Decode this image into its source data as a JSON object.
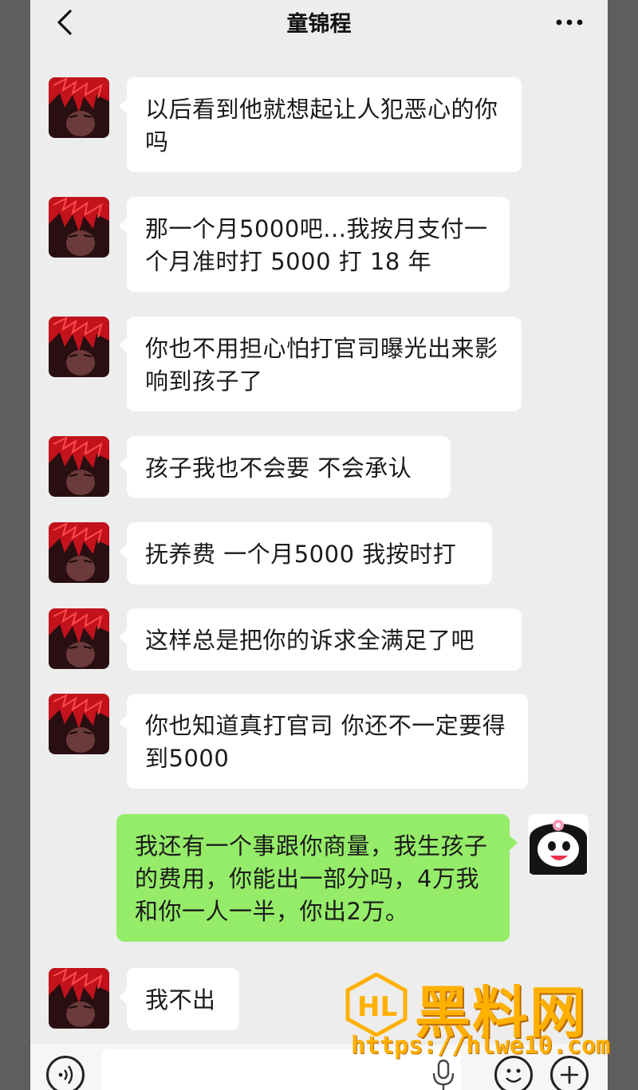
{
  "header": {
    "title": "童锦程"
  },
  "messages": [
    {
      "sender": "contact",
      "text": "以后看到他就想起让人犯恶心的你吗"
    },
    {
      "sender": "contact",
      "text": "那一个月5000吧...我按月支付一个月准时打 5000 打 18 年"
    },
    {
      "sender": "contact",
      "text": "你也不用担心怕打官司曝光出来影响到孩子了"
    },
    {
      "sender": "contact",
      "text": "孩子我也不会要 不会承认"
    },
    {
      "sender": "contact",
      "text": "抚养费 一个月5000 我按时打"
    },
    {
      "sender": "contact",
      "text": "这样总是把你的诉求全满足了吧"
    },
    {
      "sender": "contact",
      "text": "你也知道真打官司 你还不一定要得到5000"
    },
    {
      "sender": "me",
      "text": "我还有一个事跟你商量，我生孩子的费用，你能出一部分吗，4万我和你一人一半，你出2万。"
    },
    {
      "sender": "contact",
      "text": "我不出"
    }
  ],
  "watermark": {
    "brand": "黑料网",
    "url": "https://hlwe10.com"
  },
  "colors": {
    "chat_background": "#ededed",
    "own_bubble": "#95ec69",
    "contact_bubble": "#ffffff",
    "watermark": "#ffb000"
  },
  "icons": [
    "back-chevron-icon",
    "more-dots-icon",
    "voice-icon",
    "mic-icon",
    "emoji-icon",
    "plus-icon"
  ]
}
